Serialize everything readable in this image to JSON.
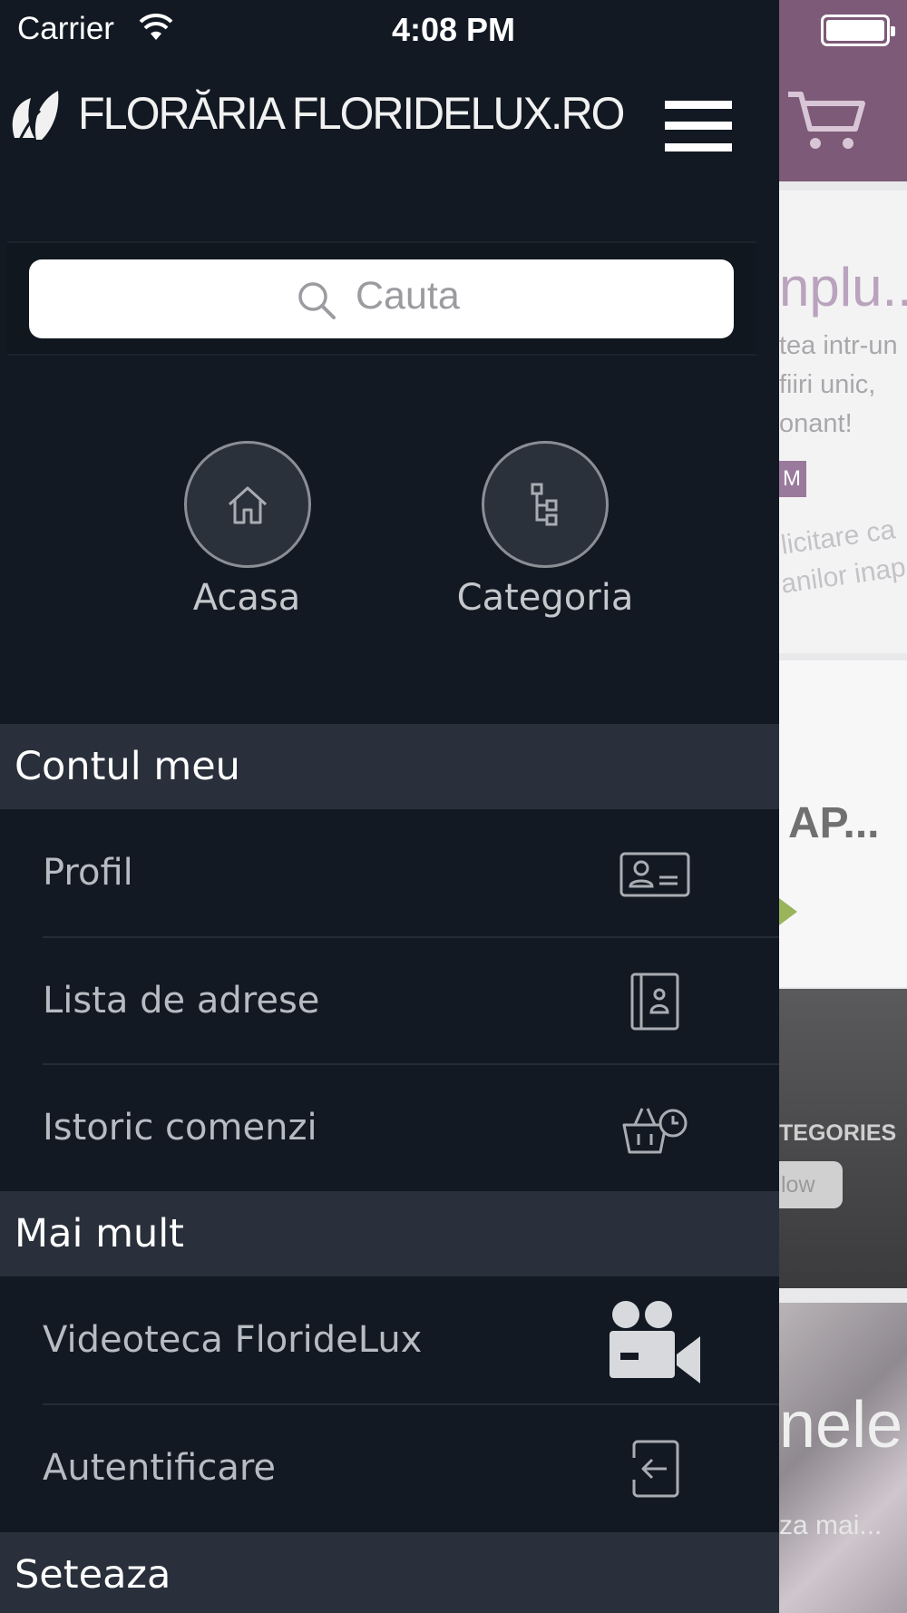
{
  "status_bar": {
    "carrier": "Carrier",
    "time": "4:08 PM"
  },
  "header": {
    "brand": "FLORĂRIA FLORIDELUX.RO"
  },
  "search": {
    "placeholder": "Cauta"
  },
  "quick_links": [
    {
      "label": "Acasa",
      "icon": "home-icon"
    },
    {
      "label": "Categoria",
      "icon": "category-tree-icon"
    }
  ],
  "sections": {
    "account": {
      "title": "Contul meu",
      "items": [
        {
          "label": "Profil",
          "icon": "profile-card-icon"
        },
        {
          "label": "Lista de adrese",
          "icon": "address-book-icon"
        },
        {
          "label": "Istoric comenzi",
          "icon": "order-history-icon"
        }
      ]
    },
    "more": {
      "title": "Mai mult",
      "items": [
        {
          "label": "Videoteca FlorideLux",
          "icon": "video-camera-icon"
        },
        {
          "label": "Autentificare",
          "icon": "login-icon"
        }
      ]
    },
    "settings": {
      "title": "Seteaza"
    }
  },
  "background": {
    "card1_title": "nplu...",
    "card1_lines": [
      "tea intr-un",
      "fiiri unic,",
      "onant!"
    ],
    "card1_badge": "M",
    "card1_slant": [
      "licitare ca",
      "anilor inap"
    ],
    "card2_title": "AP...",
    "categories_label": "TEGORIES",
    "show_button": "low",
    "card3_title": "nele",
    "card3_sub": "za mai..."
  },
  "colors": {
    "drawer_bg": "#121922",
    "section_bg": "#29303b",
    "header_accent": "#7c5a78"
  }
}
